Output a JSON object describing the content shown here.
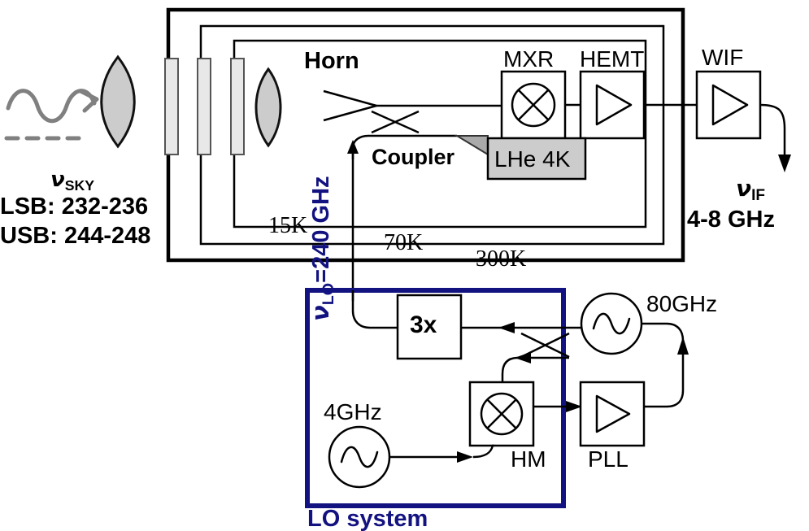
{
  "diagram": {
    "title": "Heterodyne receiver block diagram",
    "colors": {
      "line": "#000000",
      "navy": "#121280",
      "gray_fill": "#cccccc",
      "light_fill": "#e6e6e6",
      "wave_gray": "#808080"
    }
  },
  "sky": {
    "wave_icon": "sine-wave-arrow-icon",
    "dashed_icon": "dashed-ray-icon",
    "lens_icon": "lens-icon",
    "nu_symbol": "ν",
    "nu_subscript": "SKY",
    "lsb_label": "LSB: 232-236",
    "usb_label": "USB: 244-248"
  },
  "cryostat": {
    "stages": [
      {
        "label": "15K"
      },
      {
        "label": "70K"
      },
      {
        "label": "300K"
      }
    ],
    "windows": [
      {
        "name": "window-plate-300k"
      },
      {
        "name": "window-plate-70k"
      },
      {
        "name": "window-plate-15k"
      }
    ],
    "horn_label": "Horn",
    "coupler_label": "Coupler",
    "mixer_label": "MXR",
    "hemt_label": "HEMT",
    "lhe_label": "LHe 4K",
    "lens_label": "lens-icon"
  },
  "lo_label": {
    "text": "νLO=240 GHz",
    "nu_symbol": "ν",
    "nu_subscript": "LO",
    "rest": "=240 GHz"
  },
  "output": {
    "wif_label": "WIF",
    "nu_symbol": "ν",
    "nu_subscript": "IF",
    "band_label": "4-8 GHz"
  },
  "lo_system": {
    "title": "LO system",
    "multiplier_label": "3x",
    "source_80_label": "80GHz",
    "source_4_label": "4GHz",
    "harmonic_mixer_label": "HM",
    "pll_label": "PLL",
    "osc_icon": "sine-source-icon",
    "mixer_icon": "mixer-circle-x-icon",
    "amp_icon": "amplifier-triangle-icon"
  }
}
